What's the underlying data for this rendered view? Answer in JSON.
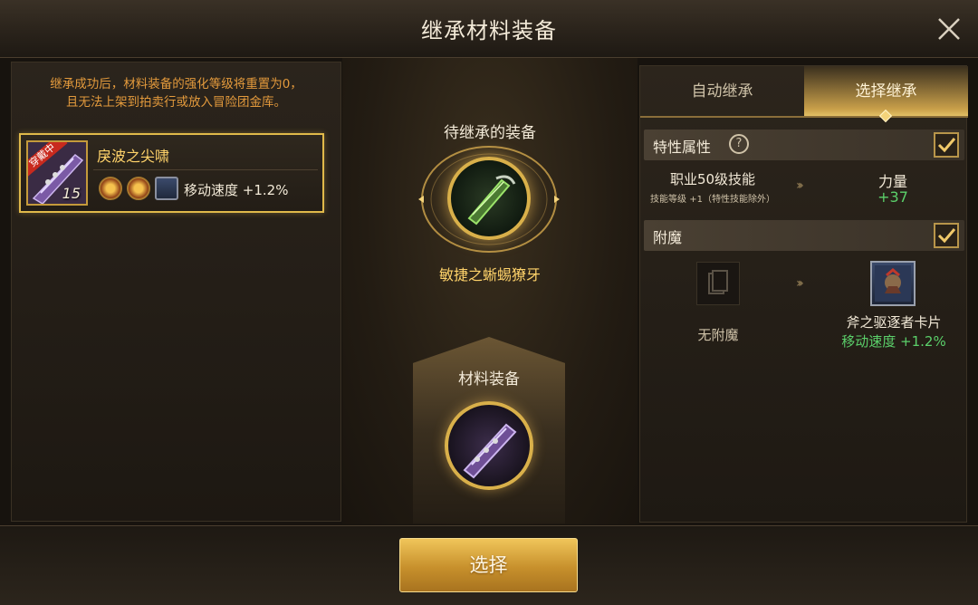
{
  "window": {
    "title": "继承材料装备"
  },
  "left": {
    "notice_line1": "继承成功后，材料装备的强化等级将重置为0，",
    "notice_line2": "且无法上架到拍卖行或放入冒险团金库。",
    "item": {
      "name": "戾波之尖啸",
      "level": "15",
      "equipped_tag": "穿戴中",
      "stat": "移动速度 +1.2%"
    }
  },
  "center": {
    "pending_label": "待继承的装备",
    "pending_item_name": "敏捷之蜥蜴獠牙",
    "material_label": "材料装备"
  },
  "right": {
    "tabs": [
      {
        "label": "自动继承",
        "active": false
      },
      {
        "label": "选择继承",
        "active": true
      }
    ],
    "trait": {
      "label": "特性属性",
      "help": "?",
      "checked": true,
      "skill_title": "职业50级技能",
      "skill_sub": "技能等级 +1（特性技能除外）",
      "stat_name": "力量",
      "stat_value": "+37"
    },
    "enchant": {
      "label": "附魔",
      "checked": true,
      "from_label": "无附魔",
      "to_name": "斧之驱逐者卡片",
      "to_stat": "移动速度 +1.2%"
    }
  },
  "footer": {
    "select_button": "选择"
  },
  "colors": {
    "accent_gold": "#e0b94a",
    "highlight_text": "#ffd36a",
    "notice": "#e39a3c",
    "positive": "#5bd06a"
  }
}
